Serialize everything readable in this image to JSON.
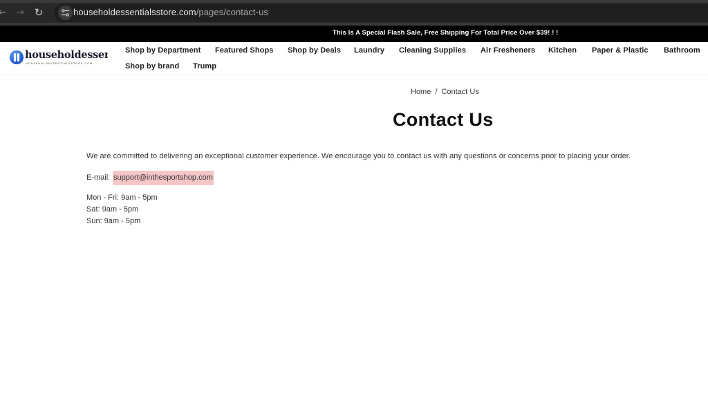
{
  "browser": {
    "back_icon": "arrow-left",
    "forward_icon": "arrow-right",
    "reload_icon": "reload",
    "site_info_icon": "tune-sliders",
    "url_domain": "householdessentialsstore.com",
    "url_path": "/pages/contact-us"
  },
  "promo": {
    "text": "This Is A Special Flash Sale, Free Shipping For Total Price Over $39!  !  !"
  },
  "header": {
    "logo_text": "householdessentia",
    "logo_subtext": "HOUSEHOLDESSENTIALSSTORE.COM",
    "nav": [
      {
        "label": "Shop by Department"
      },
      {
        "label": "Featured Shops"
      },
      {
        "label": "Shop by Deals"
      },
      {
        "label": "Laundry"
      },
      {
        "label": "Cleaning Supplies"
      },
      {
        "label": "Air Fresheners"
      },
      {
        "label": "Kitchen"
      },
      {
        "label": "Paper & Plastic"
      },
      {
        "label": "Bathroom"
      },
      {
        "label": "Shop by brand"
      },
      {
        "label": "Trump"
      }
    ]
  },
  "breadcrumb": {
    "home": "Home",
    "separator": "/",
    "current": "Contact Us"
  },
  "page": {
    "title": "Contact Us",
    "intro": "We are committed to delivering an exceptional customer experience. We encourage you to contact us with any questions or concerns prior to placing your order.",
    "email_label": "E-mail:",
    "email": "support@inthesportshop.com",
    "email_highlight_color": "#f5c6c6",
    "hours": [
      "Mon - Fri: 9am - 5pm",
      "Sat: 9am - 5pm",
      "Sun: 9am - 5pm"
    ]
  }
}
